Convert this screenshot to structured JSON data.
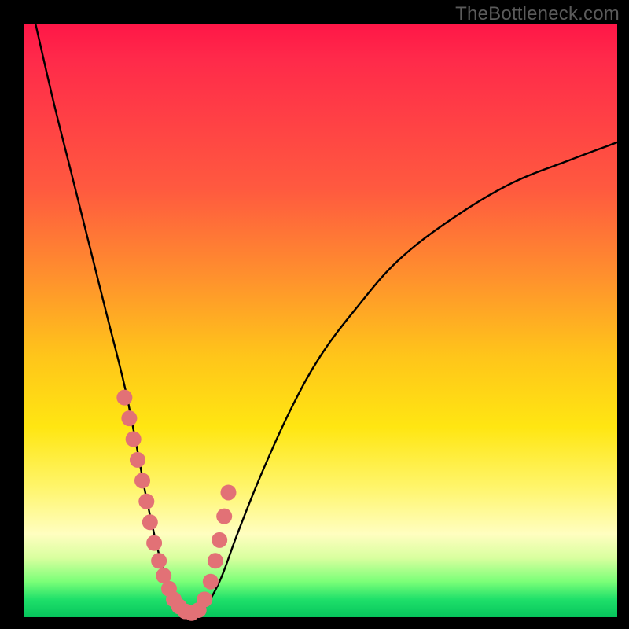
{
  "watermark": "TheBottleneck.com",
  "chart_data": {
    "type": "line",
    "title": "",
    "xlabel": "",
    "ylabel": "",
    "xlim": [
      0,
      100
    ],
    "ylim": [
      0,
      100
    ],
    "series": [
      {
        "name": "bottleneck-curve",
        "x": [
          2,
          5,
          8,
          11,
          14,
          17,
          19,
          20.5,
          22,
          23.5,
          25,
          26.5,
          28,
          30,
          33,
          36,
          40,
          45,
          50,
          56,
          63,
          72,
          82,
          92,
          100
        ],
        "values": [
          100,
          87,
          75,
          63,
          51,
          39,
          29,
          21,
          14,
          8,
          4,
          1.5,
          0.5,
          1,
          6,
          14,
          24,
          35,
          44,
          52,
          60,
          67,
          73,
          77,
          80
        ]
      }
    ],
    "markers": {
      "name": "highlight-points",
      "x": [
        17.0,
        17.8,
        18.5,
        19.2,
        20.0,
        20.7,
        21.3,
        22.0,
        22.8,
        23.6,
        24.5,
        25.3,
        26.2,
        27.2,
        28.3,
        29.5,
        30.5,
        31.5,
        32.3,
        33.0,
        33.8,
        34.5
      ],
      "values": [
        37.0,
        33.5,
        30.0,
        26.5,
        23.0,
        19.5,
        16.0,
        12.5,
        9.5,
        7.0,
        4.8,
        3.0,
        1.8,
        1.0,
        0.7,
        1.2,
        3.0,
        6.0,
        9.5,
        13.0,
        17.0,
        21.0
      ],
      "color": "#e27176",
      "radius": 10
    },
    "background_gradient": {
      "top": "#ff1647",
      "upper_mid": "#ff8e2e",
      "mid": "#ffe612",
      "lower_mid": "#fffec0",
      "bottom": "#06c55c"
    }
  }
}
